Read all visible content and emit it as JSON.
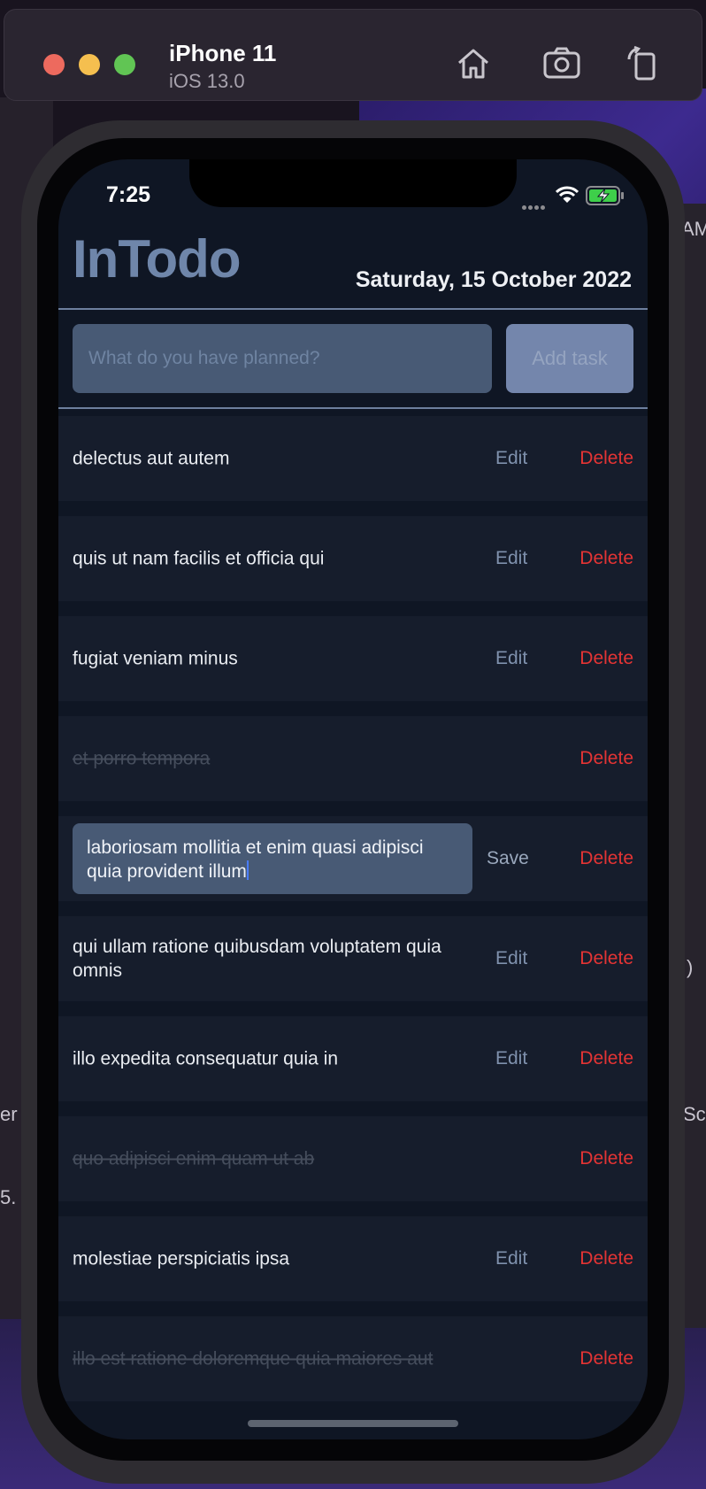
{
  "simulator": {
    "device": "iPhone 11",
    "os": "iOS 13.0"
  },
  "desktop": {
    "edge_text_right_top": "AM",
    "edge_text_left": "er",
    "edge_text_right": "Sc",
    "edge_text_left_bottom": "5.",
    "edge_text_right_paren": ")"
  },
  "status_bar": {
    "time": "7:25"
  },
  "app": {
    "title": "InTodo",
    "date": "Saturday, 15 October 2022",
    "input_placeholder": "What do you have planned?",
    "input_value": "",
    "add_button_label": "Add task"
  },
  "labels": {
    "edit": "Edit",
    "delete": "Delete",
    "save": "Save"
  },
  "tasks": [
    {
      "text": "delectus aut autem",
      "completed": false,
      "editing": false
    },
    {
      "text": "quis ut nam facilis et officia qui",
      "completed": false,
      "editing": false
    },
    {
      "text": "fugiat veniam minus",
      "completed": false,
      "editing": false
    },
    {
      "text": "et porro tempora",
      "completed": true,
      "editing": false
    },
    {
      "text": "laboriosam mollitia et enim quasi adipisci quia provident illum",
      "completed": false,
      "editing": true
    },
    {
      "text": "qui ullam ratione quibusdam voluptatem quia omnis",
      "completed": false,
      "editing": false
    },
    {
      "text": "illo expedita consequatur quia in",
      "completed": false,
      "editing": false
    },
    {
      "text": "quo adipisci enim quam ut ab",
      "completed": true,
      "editing": false
    },
    {
      "text": "molestiae perspiciatis ipsa",
      "completed": false,
      "editing": false
    },
    {
      "text": "illo est ratione doloremque quia maiores aut",
      "completed": true,
      "editing": false
    }
  ],
  "colors": {
    "app_background": "#0f1624",
    "row_background": "#161d2c",
    "title": "#6f86aa",
    "delete": "#e43434",
    "edit": "#7f91ad",
    "input_background": "#485a75",
    "button_background": "#7486ac"
  }
}
